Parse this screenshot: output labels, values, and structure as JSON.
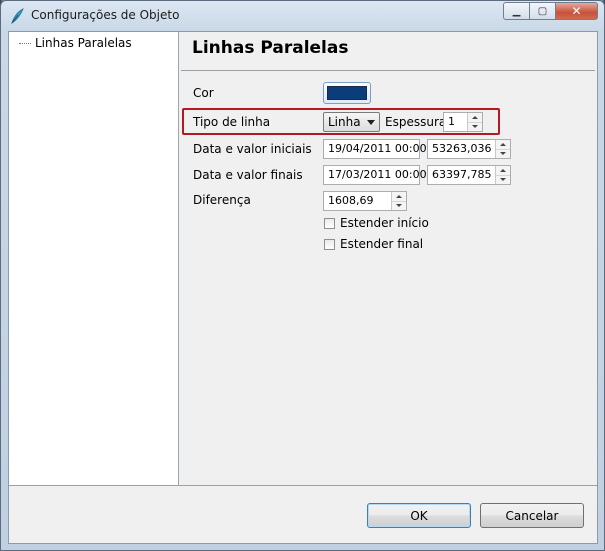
{
  "window": {
    "title": "Configurações de Objeto",
    "app_icon": "feather-icon",
    "controls": {
      "minimize": "minimize-icon",
      "maximize": "maximize-icon",
      "close": "close-icon"
    }
  },
  "tree": {
    "items": [
      {
        "label": "Linhas Paralelas",
        "selected": true
      }
    ]
  },
  "panel": {
    "title": "Linhas Paralelas",
    "color_label": "Cor",
    "color_value": "#0a3d7a",
    "line_type_label": "Tipo de linha",
    "line_type_value": "Linha",
    "thickness_label": "Espessura",
    "thickness_value": "1",
    "start_label": "Data e valor iniciais",
    "start_date": "19/04/2011 00:00",
    "start_value": "53263,036",
    "end_label": "Data e valor finais",
    "end_date": "17/03/2011 00:00",
    "end_value": "63397,785",
    "difference_label": "Diferença",
    "difference_value": "1608,69",
    "extend_start_label": "Estender início",
    "extend_start_checked": false,
    "extend_end_label": "Estender final",
    "extend_end_checked": false
  },
  "buttons": {
    "ok": "OK",
    "cancel": "Cancelar"
  },
  "colors": {
    "highlight": "#b11a24",
    "accent": "#3c7fb1"
  }
}
